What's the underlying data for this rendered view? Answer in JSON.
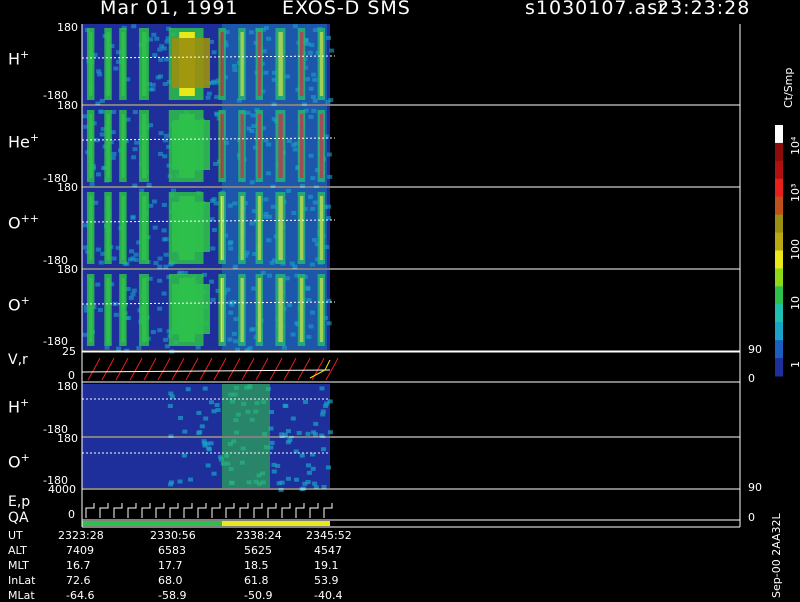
{
  "header": {
    "date": "Mar 01, 1991",
    "mission": "EXOS-D SMS",
    "file": "s1030107.asr",
    "time": "23:23:28"
  },
  "panels": [
    {
      "id": "hplus_top",
      "label": "H",
      "sup": "+",
      "ymax": "180",
      "ymin": "-180"
    },
    {
      "id": "heplus",
      "label": "He",
      "sup": "+",
      "ymax": "180",
      "ymin": "-180"
    },
    {
      "id": "oplusplus",
      "label": "O",
      "sup": "++",
      "ymax": "180",
      "ymin": "-180"
    },
    {
      "id": "oplus_top",
      "label": "O",
      "sup": "+",
      "ymax": "180",
      "ymin": "-180"
    },
    {
      "id": "vr",
      "label": "V,r",
      "ymax": "25",
      "ymin": "0",
      "rmax": "90",
      "rmin": "0"
    },
    {
      "id": "hplus_low",
      "label": "H",
      "sup": "+",
      "ymax": "180",
      "ymin": "-180"
    },
    {
      "id": "oplus_low",
      "label": "O",
      "sup": "+",
      "ymax": "180",
      "ymin": "-180"
    },
    {
      "id": "ep",
      "label": "E,p",
      "ymax": "4000",
      "ymin": "0",
      "rmax": "90",
      "rmin": "0"
    },
    {
      "id": "qa",
      "label": "QA"
    }
  ],
  "colorbar": {
    "unit": "Ct/Smp",
    "ticks": [
      "10",
      "4",
      "10",
      "3",
      "100",
      "10",
      "1"
    ],
    "tick_display": [
      "10⁴",
      "10³",
      "100",
      "10",
      "1"
    ]
  },
  "side_label": "Sep-00 2AA32L",
  "footer": {
    "rows": [
      {
        "name": "UT",
        "values": [
          "2323:28",
          "2330:56",
          "2338:24",
          "2345:52"
        ]
      },
      {
        "name": "ALT",
        "values": [
          "7409",
          "6583",
          "5625",
          "4547"
        ]
      },
      {
        "name": "MLT",
        "values": [
          "16.7",
          "17.7",
          "18.5",
          "19.1"
        ]
      },
      {
        "name": "InLat",
        "values": [
          "72.6",
          "68.0",
          "61.8",
          "53.9"
        ]
      },
      {
        "name": "MLat",
        "values": [
          "-64.6",
          "-58.9",
          "-50.9",
          "-40.4"
        ]
      }
    ]
  },
  "chart_data": {
    "type": "heatmap",
    "title": "Mar 01, 1991   EXOS-D SMS",
    "x": [
      "2323:28",
      "2330:56",
      "2338:24",
      "2345:52"
    ],
    "x_fraction_of_axis_with_data": 0.44,
    "colorscale": [
      "#1e2f9b",
      "#1aa3c8",
      "#2ec04a",
      "#e8e81a",
      "#9a8f10",
      "#e8201a",
      "#8a0c0c",
      "#ffffff"
    ],
    "color_levels_ct_per_smp": [
      1,
      10,
      100,
      1000,
      10000
    ],
    "series": [
      {
        "name": "H+",
        "ylim": [
          -180,
          180
        ],
        "sweeps": [
          [
            0.02,
            0.05
          ],
          [
            0.09,
            0.12
          ],
          [
            0.15,
            0.18
          ],
          [
            0.23,
            0.27
          ],
          [
            0.35,
            0.49
          ],
          [
            0.55,
            0.58
          ],
          [
            0.63,
            0.66
          ],
          [
            0.7,
            0.73
          ],
          [
            0.78,
            0.82
          ],
          [
            0.87,
            0.9
          ],
          [
            0.95,
            0.98
          ]
        ]
      },
      {
        "name": "He+",
        "ylim": [
          -180,
          180
        ]
      },
      {
        "name": "O++",
        "ylim": [
          -180,
          180
        ]
      },
      {
        "name": "O+",
        "ylim": [
          -180,
          180
        ]
      },
      {
        "name": "H+ (lower)",
        "ylim": [
          -180,
          180
        ]
      },
      {
        "name": "O+ (lower)",
        "ylim": [
          -180,
          180
        ]
      }
    ]
  }
}
